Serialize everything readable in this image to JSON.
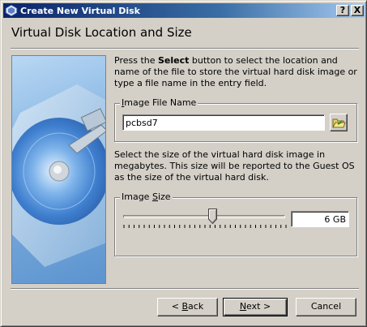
{
  "window": {
    "title": "Create New Virtual Disk",
    "help_button": "?",
    "close_button": "X"
  },
  "header": {
    "title": "Virtual Disk Location and Size"
  },
  "intro": {
    "part1": "Press the ",
    "bold": "Select",
    "part2": " button to select the location and name of the file to store the virtual hard disk image or type a file name in the entry field."
  },
  "image_file": {
    "group_label_pre": "",
    "group_label_u": "I",
    "group_label_post": "mage File Name",
    "value": "pcbsd7"
  },
  "size_description": "Select the size of the virtual hard disk image in megabytes. This size will be reported to the Guest OS as the size of the virtual hard disk.",
  "image_size": {
    "group_label_pre": "Image ",
    "group_label_u": "S",
    "group_label_post": "ize",
    "value": "6 GB",
    "slider_fraction": 0.55
  },
  "buttons": {
    "back_pre": "< ",
    "back_u": "B",
    "back_post": "ack",
    "next_u": "N",
    "next_post": "ext >",
    "cancel": "Cancel"
  },
  "icons": {
    "title_icon": "virtualbox-icon",
    "folder_icon": "open-folder-icon",
    "side_image": "hard-disk-illustration"
  }
}
